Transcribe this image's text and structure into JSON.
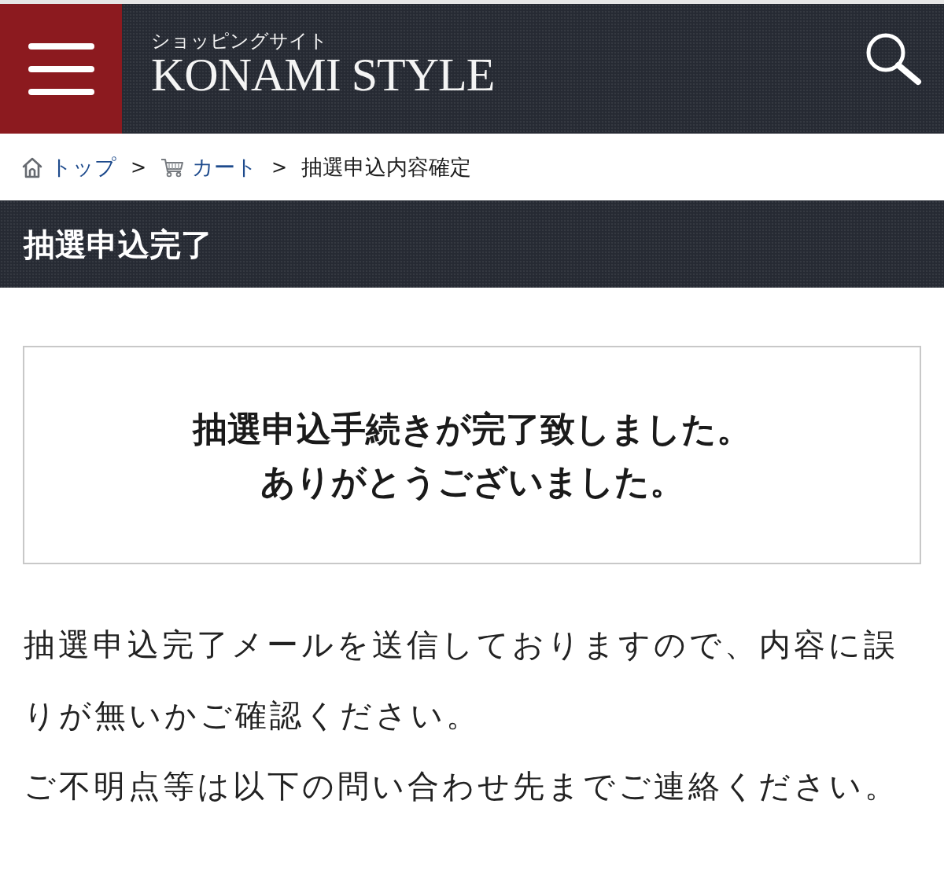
{
  "header": {
    "site_label": "ショッピングサイト",
    "logo": "KONAMI STYLE"
  },
  "breadcrumb": [
    {
      "kind": "home",
      "label": "トップ"
    },
    {
      "kind": "separator",
      "label": ">"
    },
    {
      "kind": "cart",
      "label": "カート"
    },
    {
      "kind": "separator",
      "label": ">"
    },
    {
      "kind": "current",
      "label": "抽選申込内容確定"
    }
  ],
  "page_title": "抽選申込完了",
  "message_box": {
    "lines": [
      "抽選申込手続きが完了致しました。",
      "ありがとうございました。"
    ]
  },
  "paragraphs": [
    "抽選申込完了メールを送信しておりますので、内容に誤りが無いかご確認ください。",
    "ご不明点等は以下の問い合わせ先までご連絡ください。"
  ]
}
